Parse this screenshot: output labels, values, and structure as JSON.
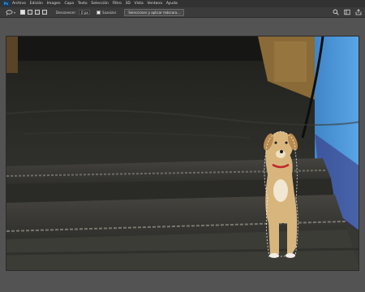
{
  "menu": {
    "items": [
      "Archivo",
      "Edición",
      "Imagen",
      "Capa",
      "Texto",
      "Selección",
      "Filtro",
      "3D",
      "Vista",
      "Ventana",
      "Ayuda"
    ]
  },
  "options": {
    "feather_label": "Desvanecer:",
    "feather_value": "0 px",
    "smooth_label": "Suavizar",
    "select_mask_label": "Seleccionar y aplicar máscara..."
  },
  "icons": {
    "tool": "lasso-icon",
    "search": "search-icon",
    "workspace": "workspace-icon",
    "share": "share-icon"
  },
  "colors": {
    "accent": "#31a8ff",
    "panel": "#535353",
    "menubar": "#323232"
  }
}
